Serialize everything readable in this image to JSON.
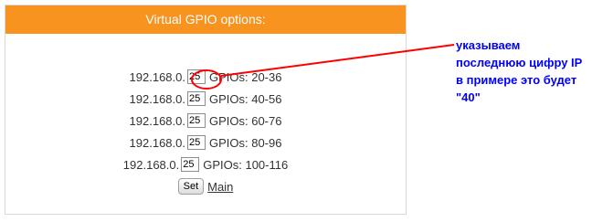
{
  "panel": {
    "title": "Virtual GPIO options:",
    "rows": [
      {
        "ip_prefix": "192.168.0.",
        "ip_value": "25",
        "gpio_text": "GPIOs: 20-36"
      },
      {
        "ip_prefix": "192.168.0.",
        "ip_value": "25",
        "gpio_text": "GPIOs: 40-56"
      },
      {
        "ip_prefix": "192.168.0.",
        "ip_value": "25",
        "gpio_text": "GPIOs: 60-76"
      },
      {
        "ip_prefix": "192.168.0.",
        "ip_value": "25",
        "gpio_text": "GPIOs: 80-96"
      },
      {
        "ip_prefix": "192.168.0.",
        "ip_value": "25",
        "gpio_text": "GPIOs: 100-116"
      }
    ],
    "set_label": "Set",
    "main_link": "Main"
  },
  "annotation": {
    "text": "указываем\nпоследнюю цифру IP\nв примере это будет\n\"40\"",
    "color": "#0000ff",
    "circle_color": "#ff0000"
  },
  "colors": {
    "header_bg": "#f7931e",
    "header_text": "#ffffff"
  }
}
